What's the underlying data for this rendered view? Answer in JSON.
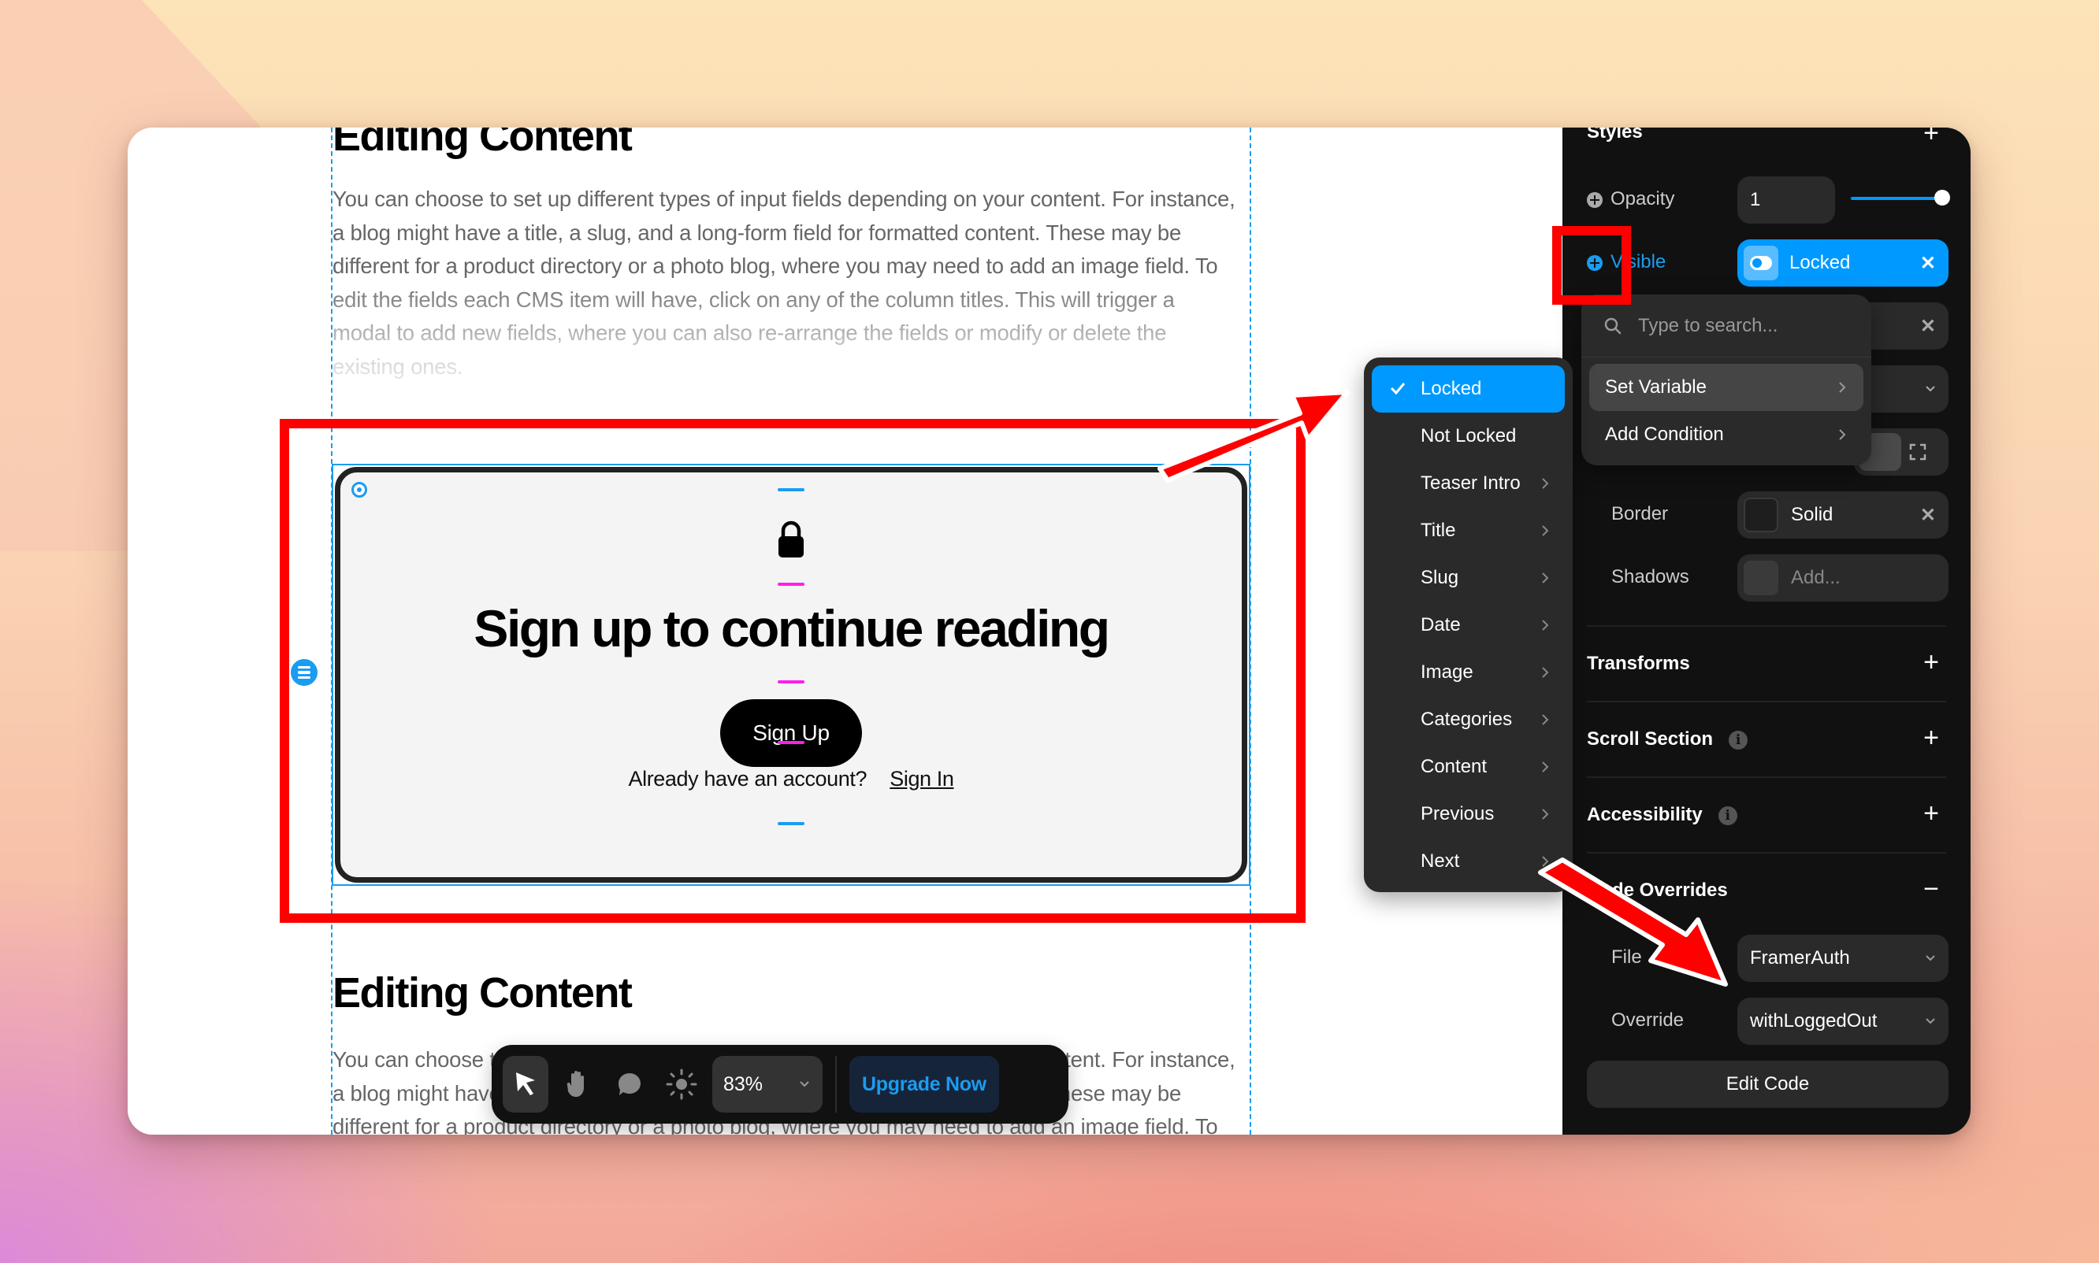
{
  "canvas": {
    "top_heading": "Editing Content",
    "top_paragraph_lines": [
      "You can choose to set up different types of input fields depending on your content. For instance,",
      "a blog might have a title, a slug, and a long-form field for formatted content. These may be",
      "different for a product directory or a photo blog, where you may need to add an image field. To",
      "edit the fields each CMS item will have, click on any of the column titles. This will trigger a",
      "modal to add new fields, where you can also re-arrange the fields or modify or delete the",
      "existing ones."
    ],
    "card": {
      "title": "Sign up to continue reading",
      "button_label": "Sign Up",
      "account_prompt": "Already have an account?",
      "signin_link": "Sign In"
    },
    "bottom_heading": "Editing Content",
    "bottom_paragraph_lines": [
      "You can choose to set up different types of input fields depending on your content. For instance,",
      "a blog might have a title, a slug, and a long-form field for formatted content. These may be",
      "different for a product directory or a photo blog, where you may need to add an image field. To"
    ]
  },
  "toolbar": {
    "tools": [
      {
        "name": "select",
        "icon": "cursor-icon",
        "active": true
      },
      {
        "name": "hand",
        "icon": "hand-icon",
        "active": false
      },
      {
        "name": "comment",
        "icon": "comment-icon",
        "active": false
      },
      {
        "name": "theme",
        "icon": "sun-icon",
        "active": false
      }
    ],
    "zoom_value": "83%",
    "upgrade_label": "Upgrade Now"
  },
  "panel": {
    "styles_title": "Styles",
    "opacity_label": "Opacity",
    "opacity_value": "1",
    "opacity_slider_fraction": 1.0,
    "visible_label": "Visible",
    "visible_value": "Locked",
    "border_label": "Border",
    "border_value": "Solid",
    "shadows_label": "Shadows",
    "shadows_placeholder": "Add...",
    "sections": [
      {
        "title": "Transforms",
        "info": false,
        "action": "+"
      },
      {
        "title": "Scroll Section",
        "info": true,
        "action": "+"
      },
      {
        "title": "Accessibility",
        "info": true,
        "action": "+"
      },
      {
        "title": "Code Overrides",
        "info": false,
        "action": "−"
      }
    ],
    "file_label": "File",
    "file_value": "FramerAuth",
    "override_label": "Override",
    "override_value": "withLoggedOut",
    "edit_code_label": "Edit Code"
  },
  "popover": {
    "search_placeholder": "Type to search...",
    "items": [
      "Set Variable",
      "Add Condition"
    ]
  },
  "variable_menu": {
    "items": [
      {
        "label": "Locked",
        "selected": true,
        "submenu": false
      },
      {
        "label": "Not Locked",
        "selected": false,
        "submenu": false
      },
      {
        "label": "Teaser Intro",
        "selected": false,
        "submenu": true
      },
      {
        "label": "Title",
        "selected": false,
        "submenu": true
      },
      {
        "label": "Slug",
        "selected": false,
        "submenu": true
      },
      {
        "label": "Date",
        "selected": false,
        "submenu": true
      },
      {
        "label": "Image",
        "selected": false,
        "submenu": true
      },
      {
        "label": "Categories",
        "selected": false,
        "submenu": true
      },
      {
        "label": "Content",
        "selected": false,
        "submenu": true
      },
      {
        "label": "Previous",
        "selected": false,
        "submenu": true
      },
      {
        "label": "Next",
        "selected": false,
        "submenu": true
      }
    ]
  },
  "colors": {
    "accent": "#0099ff",
    "annotation": "#ff0000",
    "panel_bg": "#111111",
    "guide_pink": "#ff20e8"
  }
}
